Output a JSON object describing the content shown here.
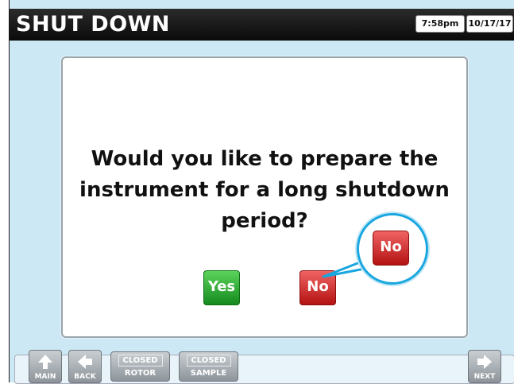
{
  "header": {
    "title": "SHUT DOWN",
    "time": "7:58pm",
    "date": "10/17/17"
  },
  "dialog": {
    "question_line1": "Would you like to prepare the",
    "question_line2": "instrument for a long shutdown",
    "question_line3": "period?",
    "yes_label": "Yes",
    "no_label": "No",
    "callout_label": "No"
  },
  "footer": {
    "main_label": "MAIN",
    "back_label": "BACK",
    "rotor_state": "CLOSED",
    "rotor_label": "ROTOR",
    "sample_state": "CLOSED",
    "sample_label": "SAMPLE",
    "next_label": "NEXT"
  },
  "colors": {
    "background": "#cde8f5",
    "yes": "#1c9a2a",
    "no": "#c41818",
    "callout_ring": "#1aa7e0"
  },
  "icons": [
    "arrow-up-icon",
    "arrow-left-icon",
    "arrow-right-icon"
  ]
}
